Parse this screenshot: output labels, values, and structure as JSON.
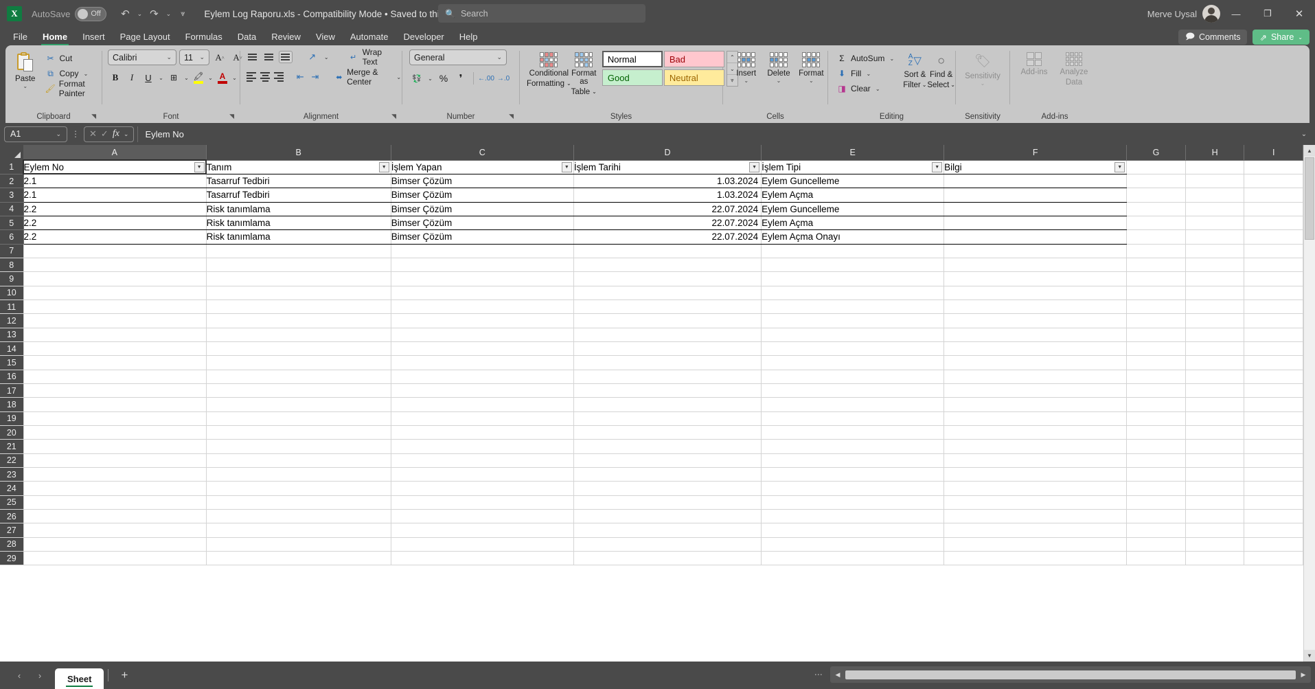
{
  "titlebar": {
    "autosave_label": "AutoSave",
    "autosave_state": "Off",
    "doc_title": "Eylem Log Raporu.xls  -  Compatibility Mode • Saved to this PC",
    "search_placeholder": "Search",
    "user_name": "Merve Uysal",
    "minimize": "—",
    "restore": "❐",
    "close": "✕"
  },
  "ribbon_tabs": {
    "items": [
      {
        "label": "File"
      },
      {
        "label": "Home"
      },
      {
        "label": "Insert"
      },
      {
        "label": "Page Layout"
      },
      {
        "label": "Formulas"
      },
      {
        "label": "Data"
      },
      {
        "label": "Review"
      },
      {
        "label": "View"
      },
      {
        "label": "Automate"
      },
      {
        "label": "Developer"
      },
      {
        "label": "Help"
      }
    ],
    "active": "Home",
    "comments_label": "Comments",
    "share_label": "Share",
    "share_color": "#5fbd87"
  },
  "ribbon": {
    "clipboard": {
      "group_label": "Clipboard",
      "paste_label": "Paste",
      "cut_label": "Cut",
      "copy_label": "Copy",
      "format_painter_label": "Format Painter"
    },
    "font": {
      "group_label": "Font",
      "font_name": "Calibri",
      "font_size": "11",
      "grow_label": "A",
      "shrink_label": "A",
      "bold_label": "B",
      "italic_label": "I",
      "underline_label": "U",
      "fill_color": "#ffff00",
      "font_color": "#c00000"
    },
    "alignment": {
      "group_label": "Alignment",
      "wrap_text_label": "Wrap Text",
      "merge_center_label": "Merge & Center"
    },
    "number": {
      "group_label": "Number",
      "format_value": "General",
      "percent_label": "%",
      "comma_label": "❜"
    },
    "styles": {
      "group_label": "Styles",
      "conditional_formatting_label": "Conditional\nFormatting",
      "cf_line1": "Conditional",
      "cf_line2": "Formatting",
      "fat_line1": "Format as",
      "fat_line2": "Table",
      "gallery": [
        {
          "label": "Normal",
          "bg": "#ffffff",
          "fg": "#000000",
          "selected": true
        },
        {
          "label": "Bad",
          "bg": "#ffc7ce",
          "fg": "#9c0006",
          "selected": false
        },
        {
          "label": "Good",
          "bg": "#c6efce",
          "fg": "#006100",
          "selected": false
        },
        {
          "label": "Neutral",
          "bg": "#ffeb9c",
          "fg": "#9c6500",
          "selected": false
        }
      ]
    },
    "cells": {
      "group_label": "Cells",
      "insert_label": "Insert",
      "delete_label": "Delete",
      "format_label": "Format"
    },
    "editing": {
      "group_label": "Editing",
      "autosum_label": "AutoSum",
      "fill_label": "Fill",
      "clear_label": "Clear",
      "sort_filter_line1": "Sort &",
      "sort_filter_line2": "Filter",
      "find_select_line1": "Find &",
      "find_select_line2": "Select"
    },
    "sensitivity": {
      "group_label": "Sensitivity",
      "button_label": "Sensitivity"
    },
    "addins": {
      "group_label": "Add-ins",
      "button_label": "Add-ins",
      "analyze_line1": "Analyze",
      "analyze_line2": "Data"
    }
  },
  "formula_bar": {
    "name_box": "A1",
    "cancel_icon": "✕",
    "enter_icon": "✓",
    "fx_label": "fx",
    "formula_value": "Eylem No"
  },
  "sheet": {
    "column_headers": [
      "A",
      "B",
      "C",
      "D",
      "E",
      "F",
      "G",
      "H",
      "I"
    ],
    "selected_column": "A",
    "table_headers": [
      "Eylem No",
      "Tanım",
      "İşlem Yapan",
      "İşlem Tarihi",
      "İşlem Tipi",
      "Bilgi"
    ],
    "rows": [
      {
        "row": "2",
        "cells": [
          "2.1",
          "Tasarruf Tedbiri",
          "Bimser Çözüm",
          "1.03.2024",
          "Eylem Guncelleme",
          ""
        ]
      },
      {
        "row": "3",
        "cells": [
          "2.1",
          "Tasarruf Tedbiri",
          "Bimser Çözüm",
          "1.03.2024",
          "Eylem Açma",
          ""
        ]
      },
      {
        "row": "4",
        "cells": [
          "2.2",
          "Risk tanımlama",
          "Bimser Çözüm",
          "22.07.2024",
          "Eylem Guncelleme",
          ""
        ]
      },
      {
        "row": "5",
        "cells": [
          "2.2",
          "Risk tanımlama",
          "Bimser Çözüm",
          "22.07.2024",
          "Eylem Açma",
          ""
        ]
      },
      {
        "row": "6",
        "cells": [
          "2.2",
          "Risk tanımlama",
          "Bimser Çözüm",
          "22.07.2024",
          "Eylem Açma Onayı",
          ""
        ]
      }
    ],
    "header_row_number": "1",
    "empty_row_numbers": [
      "7",
      "8",
      "9",
      "10",
      "11",
      "12",
      "13",
      "14",
      "15",
      "16",
      "17",
      "18",
      "19",
      "20",
      "21",
      "22",
      "23",
      "24",
      "25",
      "26",
      "27",
      "28",
      "29"
    ]
  },
  "status_bar": {
    "prev_sheet": "‹",
    "next_sheet": "›",
    "sheet_name": "Sheet",
    "add_sheet": "+"
  }
}
